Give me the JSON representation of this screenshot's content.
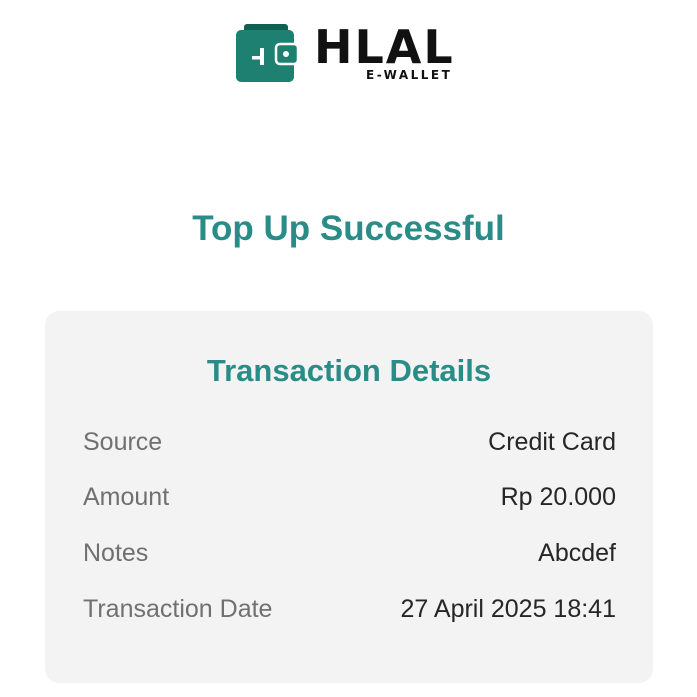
{
  "brand": {
    "name": "HLAL",
    "subtitle": "E-WALLET",
    "color": "#1d8070",
    "icon": "wallet-icon"
  },
  "status": {
    "title": "Top Up Successful",
    "color": "#2a8c87"
  },
  "transaction": {
    "title": "Transaction Details",
    "rows": [
      {
        "label": "Source",
        "value": "Credit Card"
      },
      {
        "label": "Amount",
        "value": "Rp 20.000"
      },
      {
        "label": "Notes",
        "value": "Abcdef"
      },
      {
        "label": "Transaction Date",
        "value": "27 April 2025 18:41"
      }
    ]
  }
}
